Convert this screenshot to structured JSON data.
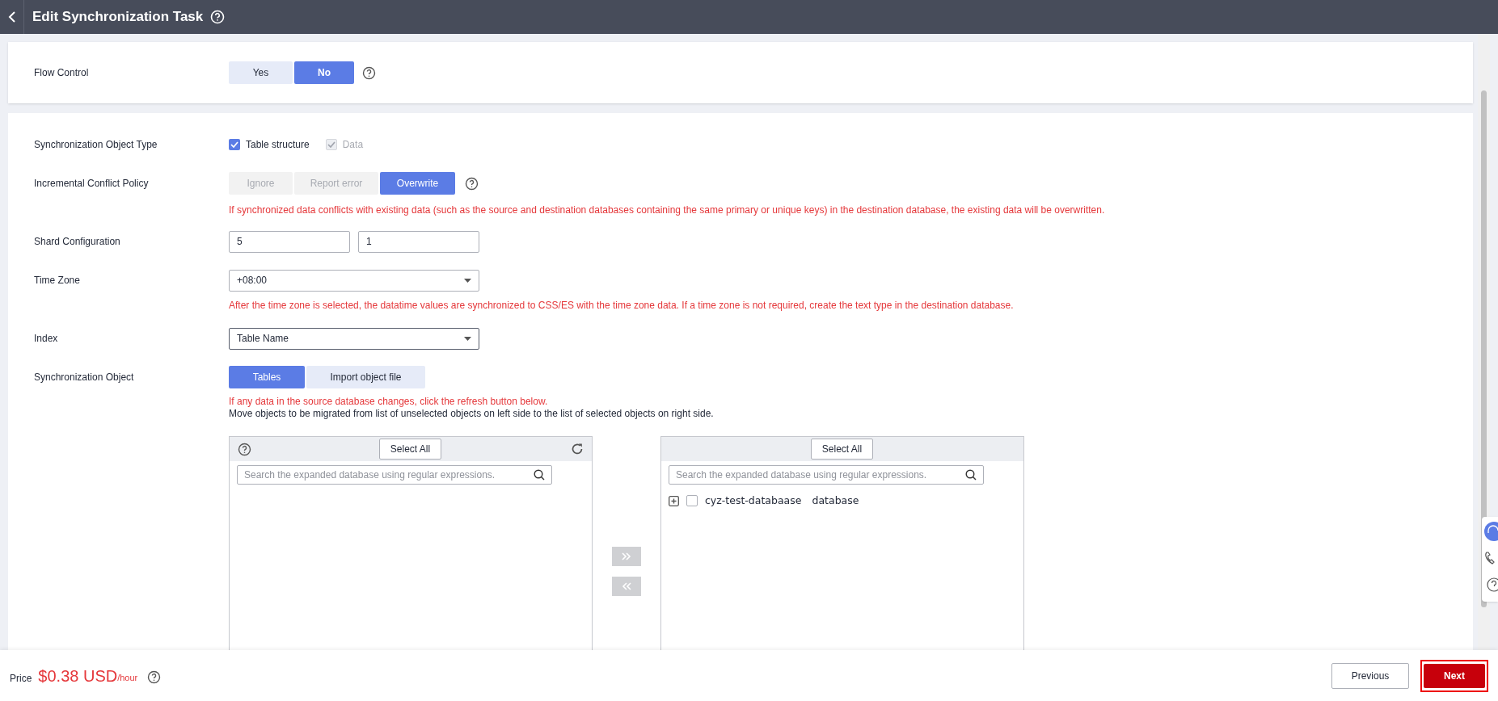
{
  "header": {
    "title": "Edit Synchronization Task"
  },
  "flow_control": {
    "label": "Flow Control",
    "options": [
      {
        "label": "Yes",
        "selected": false
      },
      {
        "label": "No",
        "selected": true
      }
    ]
  },
  "object_type": {
    "label": "Synchronization Object Type",
    "options": [
      {
        "label": "Table structure",
        "checked": true,
        "disabled": false
      },
      {
        "label": "Data",
        "checked": true,
        "disabled": true
      }
    ]
  },
  "conflict_policy": {
    "label": "Incremental Conflict Policy",
    "options": [
      {
        "label": "Ignore",
        "selected": false,
        "disabled": true
      },
      {
        "label": "Report error",
        "selected": false,
        "disabled": true
      },
      {
        "label": "Overwrite",
        "selected": true,
        "disabled": false
      }
    ],
    "note": "If synchronized data conflicts with existing data (such as the source and destination databases containing the same primary or unique keys) in the destination database, the existing data will be overwritten."
  },
  "shard": {
    "label": "Shard Configuration",
    "fields": [
      {
        "value": "5"
      },
      {
        "value": "1"
      }
    ]
  },
  "time_zone": {
    "label": "Time Zone",
    "value": "+08:00",
    "note": "After the time zone is selected, the datatime values are synchronized to CSS/ES with the time zone data. If a time zone is not required, create the text type in the destination database."
  },
  "index": {
    "label": "Index",
    "value": "Table Name"
  },
  "sync_object": {
    "label": "Synchronization Object",
    "tabs": [
      {
        "label": "Tables",
        "selected": true
      },
      {
        "label": "Import object file",
        "selected": false
      }
    ],
    "note": "If any data in the source database changes, click the refresh button below.",
    "hint": "Move objects to be migrated from list of unselected objects on left side to the list of selected objects on right side."
  },
  "left_panel": {
    "select_all": "Select All",
    "placeholder": "Search the expanded database using regular expressions."
  },
  "right_panel": {
    "select_all": "Select All",
    "placeholder": "Search the expanded database using regular expressions.",
    "items": [
      {
        "name": "cyz-test-databaase",
        "type": "database",
        "checked": false,
        "expanded": false
      }
    ]
  },
  "footer": {
    "price_label": "Price",
    "price": "$0.38 USD",
    "unit": "/hour",
    "previous": "Previous",
    "next": "Next"
  }
}
